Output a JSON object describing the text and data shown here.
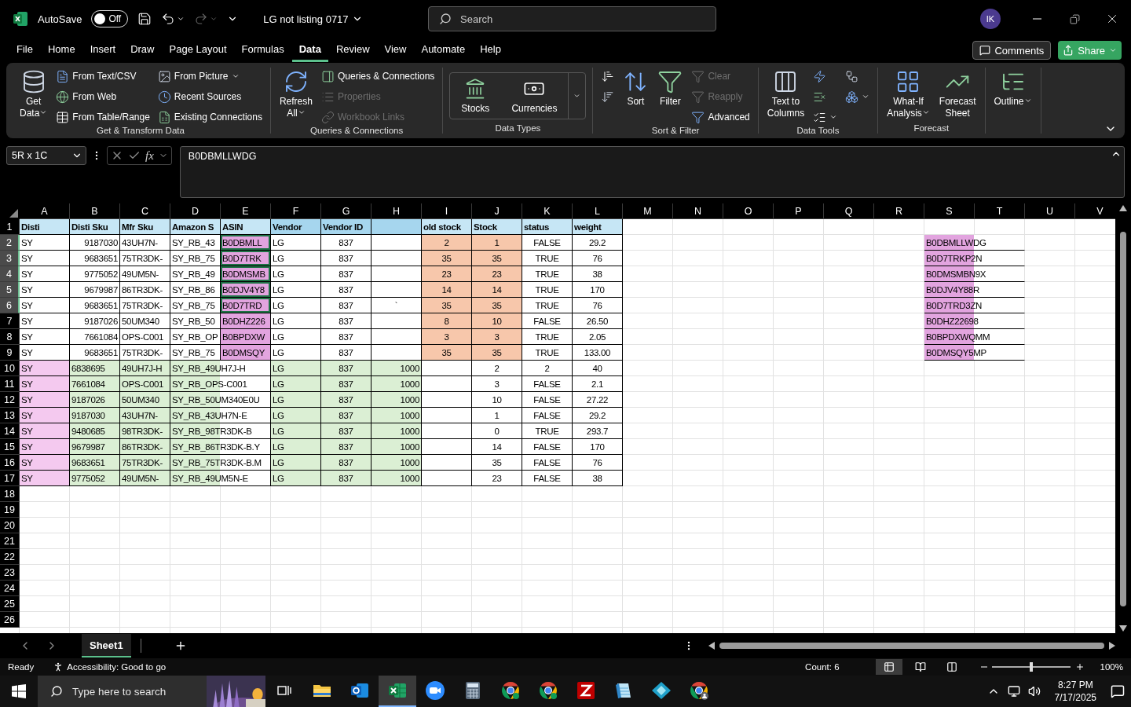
{
  "title_bar": {
    "autosave_label": "AutoSave",
    "autosave": {
      "on": false,
      "label": "Off"
    },
    "document_title": "LG not listing 0717",
    "search": {
      "placeholder": "Search"
    },
    "avatar": "IK"
  },
  "menu_tabs": [
    {
      "label": "File",
      "selected": false
    },
    {
      "label": "Home",
      "selected": false
    },
    {
      "label": "Insert",
      "selected": false
    },
    {
      "label": "Draw",
      "selected": false
    },
    {
      "label": "Page Layout",
      "selected": false
    },
    {
      "label": "Formulas",
      "selected": false
    },
    {
      "label": "Data",
      "selected": true
    },
    {
      "label": "Review",
      "selected": false
    },
    {
      "label": "View",
      "selected": false
    },
    {
      "label": "Automate",
      "selected": false
    },
    {
      "label": "Help",
      "selected": false
    }
  ],
  "menu_buttons": {
    "comments": "Comments",
    "share": "Share"
  },
  "ribbon": {
    "groups": [
      {
        "label": "Get & Transform Data",
        "items": [
          {
            "label": "Get\nData",
            "kind": "large",
            "dropdown": true,
            "disabled": false
          },
          {
            "label": "From Text/CSV",
            "kind": "small",
            "dropdown": false,
            "disabled": false
          },
          {
            "label": "From Web",
            "kind": "small",
            "dropdown": false,
            "disabled": false
          },
          {
            "label": "From Table/Range",
            "kind": "small",
            "dropdown": false,
            "disabled": false
          },
          {
            "label": "From Picture",
            "kind": "small",
            "dropdown": true,
            "disabled": false
          },
          {
            "label": "Recent Sources",
            "kind": "small",
            "dropdown": false,
            "disabled": false
          },
          {
            "label": "Existing Connections",
            "kind": "small",
            "dropdown": false,
            "disabled": false
          }
        ]
      },
      {
        "label": "Queries & Connections",
        "items": [
          {
            "label": "Refresh\nAll",
            "kind": "large",
            "dropdown": true,
            "disabled": false
          },
          {
            "label": "Queries & Connections",
            "kind": "small",
            "dropdown": false,
            "disabled": false
          },
          {
            "label": "Properties",
            "kind": "small",
            "dropdown": false,
            "disabled": true
          },
          {
            "label": "Workbook Links",
            "kind": "small",
            "dropdown": false,
            "disabled": true
          }
        ]
      },
      {
        "label": "Data Types",
        "items": [
          {
            "label": "Stocks",
            "kind": "gallery",
            "dropdown": false,
            "disabled": false
          },
          {
            "label": "Currencies",
            "kind": "gallery",
            "dropdown": false,
            "disabled": false
          }
        ]
      },
      {
        "label": "Sort & Filter",
        "items": [
          {
            "kind": "icon",
            "dropdown": false,
            "disabled": false
          },
          {
            "kind": "icon",
            "dropdown": false,
            "disabled": false
          },
          {
            "label": "Sort",
            "kind": "large",
            "dropdown": false,
            "disabled": false
          },
          {
            "label": "Filter",
            "kind": "large",
            "dropdown": false,
            "disabled": false
          },
          {
            "label": "Clear",
            "kind": "small",
            "dropdown": false,
            "disabled": true
          },
          {
            "label": "Reapply",
            "kind": "small",
            "dropdown": false,
            "disabled": true
          },
          {
            "label": "Advanced",
            "kind": "small",
            "dropdown": false,
            "disabled": false
          }
        ]
      },
      {
        "label": "Data Tools",
        "items": [
          {
            "label": "Text to\nColumns",
            "kind": "large",
            "dropdown": false,
            "disabled": false
          },
          {
            "kind": "icon",
            "dropdown": false,
            "disabled": false
          },
          {
            "kind": "icon",
            "dropdown": false,
            "disabled": false
          },
          {
            "kind": "icon",
            "dropdown": true,
            "disabled": false
          },
          {
            "kind": "icon",
            "dropdown": false,
            "disabled": false
          },
          {
            "kind": "icon",
            "dropdown": true,
            "disabled": false
          }
        ]
      },
      {
        "label": "Forecast",
        "items": [
          {
            "label": "What-If\nAnalysis",
            "kind": "large",
            "dropdown": true,
            "disabled": false
          },
          {
            "label": "Forecast\nSheet",
            "kind": "large",
            "dropdown": false,
            "disabled": false
          }
        ]
      },
      {
        "items": [
          {
            "label": "Outline",
            "kind": "large",
            "dropdown": true,
            "disabled": false
          }
        ]
      }
    ]
  },
  "formula_bar": {
    "name_box": "5R x 1C",
    "function_label": "fx",
    "formula": "B0DBMLLWDG"
  },
  "sheet": {
    "columns": [
      "A",
      "B",
      "C",
      "D",
      "E",
      "F",
      "G",
      "H",
      "I",
      "J",
      "K",
      "L",
      "M",
      "N",
      "O",
      "P",
      "Q",
      "R",
      "S",
      "T",
      "U",
      "V"
    ],
    "rows": [
      {
        "number": "1",
        "cells": [
          {
            "text": "Disti",
            "kind": "heading",
            "color": "#c6e6f5",
            "selected": false
          },
          {
            "text": "Disti Sku",
            "kind": "heading",
            "color": "#c6e6f5",
            "selected": false
          },
          {
            "text": "Mfr Sku",
            "kind": "heading",
            "color": "#c6e6f5",
            "selected": false
          },
          {
            "text": "Amazon S",
            "kind": "heading",
            "color": "#c6e6f5",
            "selected": false
          },
          {
            "text": "ASIN",
            "kind": "heading",
            "color": "#c6e6f5",
            "selected": false
          },
          {
            "text": "Vendor",
            "kind": "heading",
            "color": "#a6d6ee",
            "selected": false
          },
          {
            "text": "Vendor ID",
            "kind": "heading",
            "color": "#a6d6ee",
            "selected": false
          },
          {
            "kind": "blank",
            "color": "#a6d6ee",
            "selected": false
          },
          {
            "text": "old stock",
            "kind": "heading",
            "color": "#c6e6f5",
            "selected": false
          },
          {
            "text": "Stock",
            "kind": "heading",
            "color": "#c6e6f5",
            "selected": false
          },
          {
            "text": "status",
            "kind": "heading",
            "color": "#c6e6f5",
            "selected": false
          },
          {
            "text": "weight",
            "kind": "heading",
            "color": "#c6e6f5",
            "selected": false
          }
        ]
      },
      {
        "number": "2",
        "cells": [
          {
            "text": "SY",
            "kind": "text",
            "selected": false
          },
          {
            "text": "9187030",
            "kind": "number",
            "selected": false
          },
          {
            "text": "43UH7N-",
            "kind": "text",
            "selected": false
          },
          {
            "text": "SY_RB_43",
            "kind": "text",
            "selected": false
          },
          {
            "text": "B0DBMLL",
            "kind": "text",
            "color": "#e2a4df",
            "selected": true
          },
          {
            "text": "LG",
            "kind": "text",
            "selected": false
          },
          {
            "text": "837",
            "kind": "center",
            "selected": false
          },
          {
            "kind": "blank",
            "selected": false
          },
          {
            "text": "2",
            "kind": "center",
            "color": "#f7c7ab",
            "selected": false
          },
          {
            "text": "1",
            "kind": "center",
            "color": "#f7c7ab",
            "selected": false
          },
          {
            "text": "FALSE",
            "kind": "center",
            "selected": false
          },
          {
            "text": "29.2",
            "kind": "center",
            "selected": false
          },
          {
            "kind": "empty"
          },
          {
            "kind": "empty"
          },
          {
            "kind": "empty"
          },
          {
            "kind": "empty"
          },
          {
            "kind": "empty"
          },
          {
            "kind": "empty"
          },
          {
            "text": "B0DBMLLWDG",
            "kind": "text",
            "color": "#e2a4df",
            "overflow": true,
            "selected": false
          }
        ]
      },
      {
        "number": "3",
        "cells": [
          {
            "text": "SY",
            "kind": "text",
            "selected": false
          },
          {
            "text": "9683651",
            "kind": "number",
            "selected": false
          },
          {
            "text": "75TR3DK-",
            "kind": "text",
            "selected": false
          },
          {
            "text": "SY_RB_75",
            "kind": "text",
            "selected": false
          },
          {
            "text": "B0D7TRK",
            "kind": "text",
            "color": "#e2a4df",
            "selected": true
          },
          {
            "text": "LG",
            "kind": "text",
            "selected": false
          },
          {
            "text": "837",
            "kind": "center",
            "selected": false
          },
          {
            "kind": "blank",
            "selected": false
          },
          {
            "text": "35",
            "kind": "center",
            "color": "#f7c7ab",
            "selected": false
          },
          {
            "text": "35",
            "kind": "center",
            "color": "#f7c7ab",
            "selected": false
          },
          {
            "text": "TRUE",
            "kind": "center",
            "selected": false
          },
          {
            "text": "76",
            "kind": "center",
            "selected": false
          },
          {
            "kind": "empty"
          },
          {
            "kind": "empty"
          },
          {
            "kind": "empty"
          },
          {
            "kind": "empty"
          },
          {
            "kind": "empty"
          },
          {
            "kind": "empty"
          },
          {
            "text": "B0D7TRKP2N",
            "kind": "text",
            "color": "#e2a4df",
            "overflow": true,
            "selected": false
          }
        ]
      },
      {
        "number": "4",
        "cells": [
          {
            "text": "SY",
            "kind": "text",
            "selected": false
          },
          {
            "text": "9775052",
            "kind": "number",
            "selected": false
          },
          {
            "text": "49UM5N-",
            "kind": "text",
            "selected": false
          },
          {
            "text": "SY_RB_49",
            "kind": "text",
            "selected": false
          },
          {
            "text": "B0DMSMB",
            "kind": "text",
            "color": "#e2a4df",
            "selected": true
          },
          {
            "text": "LG",
            "kind": "text",
            "selected": false
          },
          {
            "text": "837",
            "kind": "center",
            "selected": false
          },
          {
            "kind": "blank",
            "selected": false
          },
          {
            "text": "23",
            "kind": "center",
            "color": "#f7c7ab",
            "selected": false
          },
          {
            "text": "23",
            "kind": "center",
            "color": "#f7c7ab",
            "selected": false
          },
          {
            "text": "TRUE",
            "kind": "center",
            "selected": false
          },
          {
            "text": "38",
            "kind": "center",
            "selected": false
          },
          {
            "kind": "empty"
          },
          {
            "kind": "empty"
          },
          {
            "kind": "empty"
          },
          {
            "kind": "empty"
          },
          {
            "kind": "empty"
          },
          {
            "kind": "empty"
          },
          {
            "text": "B0DMSMBN9X",
            "kind": "text",
            "color": "#e2a4df",
            "overflow": true,
            "selected": false
          }
        ]
      },
      {
        "number": "5",
        "cells": [
          {
            "text": "SY",
            "kind": "text",
            "selected": false
          },
          {
            "text": "9679987",
            "kind": "number",
            "selected": false
          },
          {
            "text": "86TR3DK-",
            "kind": "text",
            "selected": false
          },
          {
            "text": "SY_RB_86",
            "kind": "text",
            "selected": false
          },
          {
            "text": "B0DJV4Y8",
            "kind": "text",
            "color": "#e2a4df",
            "selected": true
          },
          {
            "text": "LG",
            "kind": "text",
            "selected": false
          },
          {
            "text": "837",
            "kind": "center",
            "selected": false
          },
          {
            "kind": "blank",
            "selected": false
          },
          {
            "text": "14",
            "kind": "center",
            "color": "#f7c7ab",
            "selected": false
          },
          {
            "text": "14",
            "kind": "center",
            "color": "#f7c7ab",
            "selected": false
          },
          {
            "text": "TRUE",
            "kind": "center",
            "selected": false
          },
          {
            "text": "170",
            "kind": "center",
            "selected": false
          },
          {
            "kind": "empty"
          },
          {
            "kind": "empty"
          },
          {
            "kind": "empty"
          },
          {
            "kind": "empty"
          },
          {
            "kind": "empty"
          },
          {
            "kind": "empty"
          },
          {
            "text": "B0DJV4Y88R",
            "kind": "text",
            "color": "#e2a4df",
            "overflow": true,
            "selected": false
          }
        ]
      },
      {
        "number": "6",
        "cells": [
          {
            "text": "SY",
            "kind": "text",
            "selected": false
          },
          {
            "text": "9683651",
            "kind": "number",
            "selected": false
          },
          {
            "text": "75TR3DK-",
            "kind": "text",
            "selected": false
          },
          {
            "text": "SY_RB_75",
            "kind": "text",
            "selected": false
          },
          {
            "text": "B0D7TRD",
            "kind": "text",
            "color": "#e2a4df",
            "selected": true
          },
          {
            "text": "LG",
            "kind": "text",
            "selected": false
          },
          {
            "text": "837",
            "kind": "center",
            "selected": false
          },
          {
            "text": "`",
            "kind": "center",
            "selected": false
          },
          {
            "text": "35",
            "kind": "center",
            "color": "#f7c7ab",
            "selected": false
          },
          {
            "text": "35",
            "kind": "center",
            "color": "#f7c7ab",
            "selected": false
          },
          {
            "text": "TRUE",
            "kind": "center",
            "selected": false
          },
          {
            "text": "76",
            "kind": "center",
            "selected": false
          },
          {
            "kind": "empty"
          },
          {
            "kind": "empty"
          },
          {
            "kind": "empty"
          },
          {
            "kind": "empty"
          },
          {
            "kind": "empty"
          },
          {
            "kind": "empty"
          },
          {
            "text": "B0D7TRD3ZN",
            "kind": "text",
            "color": "#e2a4df",
            "overflow": true,
            "selected": false
          }
        ]
      },
      {
        "number": "7",
        "cells": [
          {
            "text": "SY",
            "kind": "text",
            "selected": false
          },
          {
            "text": "9187026",
            "kind": "number",
            "selected": false
          },
          {
            "text": "50UM340",
            "kind": "text",
            "selected": false
          },
          {
            "text": "SY_RB_50",
            "kind": "text",
            "selected": false
          },
          {
            "text": "B0DHZ226",
            "kind": "text",
            "color": "#e2a4df",
            "selected": false
          },
          {
            "text": "LG",
            "kind": "text",
            "selected": false
          },
          {
            "text": "837",
            "kind": "center",
            "selected": false
          },
          {
            "kind": "blank",
            "selected": false
          },
          {
            "text": "8",
            "kind": "center",
            "color": "#f7c7ab",
            "selected": false
          },
          {
            "text": "10",
            "kind": "center",
            "color": "#f7c7ab",
            "selected": false
          },
          {
            "text": "FALSE",
            "kind": "center",
            "selected": false
          },
          {
            "text": "26.50",
            "kind": "center",
            "selected": false
          },
          {
            "kind": "empty"
          },
          {
            "kind": "empty"
          },
          {
            "kind": "empty"
          },
          {
            "kind": "empty"
          },
          {
            "kind": "empty"
          },
          {
            "kind": "empty"
          },
          {
            "text": "B0DHZ22698",
            "kind": "text",
            "color": "#e2a4df",
            "overflow": true,
            "selected": false
          }
        ]
      },
      {
        "number": "8",
        "cells": [
          {
            "text": "SY",
            "kind": "text",
            "selected": false
          },
          {
            "text": "7661084",
            "kind": "number",
            "selected": false
          },
          {
            "text": "OPS-C001",
            "kind": "text",
            "selected": false
          },
          {
            "text": "SY_RB_OP",
            "kind": "text",
            "selected": false
          },
          {
            "text": "B0BPDXW",
            "kind": "text",
            "color": "#e2a4df",
            "selected": false
          },
          {
            "text": "LG",
            "kind": "text",
            "selected": false
          },
          {
            "text": "837",
            "kind": "center",
            "selected": false
          },
          {
            "kind": "blank",
            "selected": false
          },
          {
            "text": "3",
            "kind": "center",
            "color": "#f7c7ab",
            "selected": false
          },
          {
            "text": "3",
            "kind": "center",
            "color": "#f7c7ab",
            "selected": false
          },
          {
            "text": "TRUE",
            "kind": "center",
            "selected": false
          },
          {
            "text": "2.05",
            "kind": "center",
            "selected": false
          },
          {
            "kind": "empty"
          },
          {
            "kind": "empty"
          },
          {
            "kind": "empty"
          },
          {
            "kind": "empty"
          },
          {
            "kind": "empty"
          },
          {
            "kind": "empty"
          },
          {
            "text": "B0BPDXWQMM",
            "kind": "text",
            "color": "#e2a4df",
            "overflow": true,
            "selected": false
          }
        ]
      },
      {
        "number": "9",
        "cells": [
          {
            "text": "SY",
            "kind": "text",
            "selected": false
          },
          {
            "text": "9683651",
            "kind": "number",
            "selected": false
          },
          {
            "text": "75TR3DK-",
            "kind": "text",
            "selected": false
          },
          {
            "text": "SY_RB_75",
            "kind": "text",
            "selected": false
          },
          {
            "text": "B0DMSQY",
            "kind": "text",
            "color": "#e2a4df",
            "selected": false
          },
          {
            "text": "LG",
            "kind": "text",
            "selected": false
          },
          {
            "text": "837",
            "kind": "center",
            "selected": false
          },
          {
            "kind": "blank",
            "selected": false
          },
          {
            "text": "35",
            "kind": "center",
            "color": "#f7c7ab",
            "selected": false
          },
          {
            "text": "35",
            "kind": "center",
            "color": "#f7c7ab",
            "selected": false
          },
          {
            "text": "TRUE",
            "kind": "center",
            "selected": false
          },
          {
            "text": "133.00",
            "kind": "center",
            "selected": false
          },
          {
            "kind": "empty"
          },
          {
            "kind": "empty"
          },
          {
            "kind": "empty"
          },
          {
            "kind": "empty"
          },
          {
            "kind": "empty"
          },
          {
            "kind": "empty"
          },
          {
            "text": "B0DMSQY5MP",
            "kind": "text",
            "color": "#e2a4df",
            "overflow": true,
            "selected": false
          }
        ]
      },
      {
        "number": "10",
        "cells": [
          {
            "text": "SY",
            "kind": "text",
            "color": "#f4c9ef",
            "selected": false
          },
          {
            "text": "6838695",
            "kind": "text",
            "color": "#dbefd4",
            "selected": false
          },
          {
            "text": "49UH7J-H",
            "kind": "text",
            "color": "#dbefd4",
            "selected": false
          },
          {
            "text": "SY_RB_49UH7J-H",
            "kind": "text",
            "color": "#dbefd4",
            "overflow": true,
            "selected": false
          },
          {
            "text": "LG",
            "kind": "text",
            "color": "#dbefd4",
            "selected": false
          },
          {
            "text": "837",
            "kind": "center",
            "color": "#dbefd4",
            "selected": false
          },
          {
            "text": "1000",
            "kind": "number",
            "color": "#dbefd4",
            "selected": false
          },
          {
            "kind": "blank",
            "selected": false
          },
          {
            "text": "2",
            "kind": "center",
            "selected": false
          },
          {
            "text": "2",
            "kind": "center",
            "selected": false
          },
          {
            "text": "40",
            "kind": "center",
            "selected": false
          }
        ]
      },
      {
        "number": "11",
        "cells": [
          {
            "text": "SY",
            "kind": "text",
            "color": "#f4c9ef",
            "selected": false
          },
          {
            "text": "7661084",
            "kind": "text",
            "color": "#dbefd4",
            "selected": false
          },
          {
            "text": "OPS-C001",
            "kind": "text",
            "color": "#dbefd4",
            "selected": false
          },
          {
            "text": "SY_RB_OPS-C001",
            "kind": "text",
            "color": "#dbefd4",
            "overflow": true,
            "selected": false
          },
          {
            "text": "LG",
            "kind": "text",
            "color": "#dbefd4",
            "selected": false
          },
          {
            "text": "837",
            "kind": "center",
            "color": "#dbefd4",
            "selected": false
          },
          {
            "text": "1000",
            "kind": "number",
            "color": "#dbefd4",
            "selected": false
          },
          {
            "kind": "blank",
            "selected": false
          },
          {
            "text": "3",
            "kind": "center",
            "selected": false
          },
          {
            "text": "FALSE",
            "kind": "center",
            "selected": false
          },
          {
            "text": "2.1",
            "kind": "center",
            "selected": false
          }
        ]
      },
      {
        "number": "12",
        "cells": [
          {
            "text": "SY",
            "kind": "text",
            "color": "#f4c9ef",
            "selected": false
          },
          {
            "text": "9187026",
            "kind": "text",
            "color": "#dbefd4",
            "selected": false
          },
          {
            "text": "50UM340",
            "kind": "text",
            "color": "#dbefd4",
            "selected": false
          },
          {
            "text": "SY_RB_50UM340E0U",
            "kind": "text",
            "color": "#dbefd4",
            "overflow": true,
            "selected": false
          },
          {
            "text": "LG",
            "kind": "text",
            "color": "#dbefd4",
            "selected": false
          },
          {
            "text": "837",
            "kind": "center",
            "color": "#dbefd4",
            "selected": false
          },
          {
            "text": "1000",
            "kind": "number",
            "color": "#dbefd4",
            "selected": false
          },
          {
            "kind": "blank",
            "selected": false
          },
          {
            "text": "10",
            "kind": "center",
            "selected": false
          },
          {
            "text": "FALSE",
            "kind": "center",
            "selected": false
          },
          {
            "text": "27.22",
            "kind": "center",
            "selected": false
          }
        ]
      },
      {
        "number": "13",
        "cells": [
          {
            "text": "SY",
            "kind": "text",
            "color": "#f4c9ef",
            "selected": false
          },
          {
            "text": "9187030",
            "kind": "text",
            "color": "#dbefd4",
            "selected": false
          },
          {
            "text": "43UH7N-",
            "kind": "text",
            "color": "#dbefd4",
            "selected": false
          },
          {
            "text": "SY_RB_43UH7N-E",
            "kind": "text",
            "color": "#dbefd4",
            "overflow": true,
            "selected": false
          },
          {
            "text": "LG",
            "kind": "text",
            "color": "#dbefd4",
            "selected": false
          },
          {
            "text": "837",
            "kind": "center",
            "color": "#dbefd4",
            "selected": false
          },
          {
            "text": "1000",
            "kind": "number",
            "color": "#dbefd4",
            "selected": false
          },
          {
            "kind": "blank",
            "selected": false
          },
          {
            "text": "1",
            "kind": "center",
            "selected": false
          },
          {
            "text": "FALSE",
            "kind": "center",
            "selected": false
          },
          {
            "text": "29.2",
            "kind": "center",
            "selected": false
          }
        ]
      },
      {
        "number": "14",
        "cells": [
          {
            "text": "SY",
            "kind": "text",
            "color": "#f4c9ef",
            "selected": false
          },
          {
            "text": "9480685",
            "kind": "text",
            "color": "#dbefd4",
            "selected": false
          },
          {
            "text": "98TR3DK-",
            "kind": "text",
            "color": "#dbefd4",
            "selected": false
          },
          {
            "text": "SY_RB_98TR3DK-B",
            "kind": "text",
            "color": "#dbefd4",
            "overflow": true,
            "selected": false
          },
          {
            "text": "LG",
            "kind": "text",
            "color": "#dbefd4",
            "selected": false
          },
          {
            "text": "837",
            "kind": "center",
            "color": "#dbefd4",
            "selected": false
          },
          {
            "text": "1000",
            "kind": "number",
            "color": "#dbefd4",
            "selected": false
          },
          {
            "kind": "blank",
            "selected": false
          },
          {
            "text": "0",
            "kind": "center",
            "selected": false
          },
          {
            "text": "TRUE",
            "kind": "center",
            "selected": false
          },
          {
            "text": "293.7",
            "kind": "center",
            "selected": false
          }
        ]
      },
      {
        "number": "15",
        "cells": [
          {
            "text": "SY",
            "kind": "text",
            "color": "#f4c9ef",
            "selected": false
          },
          {
            "text": "9679987",
            "kind": "text",
            "color": "#dbefd4",
            "selected": false
          },
          {
            "text": "86TR3DK-",
            "kind": "text",
            "color": "#dbefd4",
            "selected": false
          },
          {
            "text": "SY_RB_86TR3DK-B.Y",
            "kind": "text",
            "color": "#dbefd4",
            "overflow": true,
            "selected": false
          },
          {
            "text": "LG",
            "kind": "text",
            "color": "#dbefd4",
            "selected": false
          },
          {
            "text": "837",
            "kind": "center",
            "color": "#dbefd4",
            "selected": false
          },
          {
            "text": "1000",
            "kind": "number",
            "color": "#dbefd4",
            "selected": false
          },
          {
            "kind": "blank",
            "selected": false
          },
          {
            "text": "14",
            "kind": "center",
            "selected": false
          },
          {
            "text": "FALSE",
            "kind": "center",
            "selected": false
          },
          {
            "text": "170",
            "kind": "center",
            "selected": false
          }
        ]
      },
      {
        "number": "16",
        "cells": [
          {
            "text": "SY",
            "kind": "text",
            "color": "#f4c9ef",
            "selected": false
          },
          {
            "text": "9683651",
            "kind": "text",
            "color": "#dbefd4",
            "selected": false
          },
          {
            "text": "75TR3DK-",
            "kind": "text",
            "color": "#dbefd4",
            "selected": false
          },
          {
            "text": "SY_RB_75TR3DK-B.M",
            "kind": "text",
            "color": "#dbefd4",
            "overflow": true,
            "selected": false
          },
          {
            "text": "LG",
            "kind": "text",
            "color": "#dbefd4",
            "selected": false
          },
          {
            "text": "837",
            "kind": "center",
            "color": "#dbefd4",
            "selected": false
          },
          {
            "text": "1000",
            "kind": "number",
            "color": "#dbefd4",
            "selected": false
          },
          {
            "kind": "blank",
            "selected": false
          },
          {
            "text": "35",
            "kind": "center",
            "selected": false
          },
          {
            "text": "FALSE",
            "kind": "center",
            "selected": false
          },
          {
            "text": "76",
            "kind": "center",
            "selected": false
          }
        ]
      },
      {
        "number": "17",
        "cells": [
          {
            "text": "SY",
            "kind": "text",
            "color": "#f4c9ef",
            "selected": false
          },
          {
            "text": "9775052",
            "kind": "text",
            "color": "#dbefd4",
            "selected": false
          },
          {
            "text": "49UM5N-",
            "kind": "text",
            "color": "#dbefd4",
            "selected": false
          },
          {
            "text": "SY_RB_49UM5N-E",
            "kind": "text",
            "color": "#dbefd4",
            "overflow": true,
            "selected": false
          },
          {
            "text": "LG",
            "kind": "text",
            "color": "#dbefd4",
            "selected": false
          },
          {
            "text": "837",
            "kind": "center",
            "color": "#dbefd4",
            "selected": false
          },
          {
            "text": "1000",
            "kind": "number",
            "color": "#dbefd4",
            "selected": false
          },
          {
            "kind": "blank",
            "selected": false
          },
          {
            "text": "23",
            "kind": "center",
            "selected": false
          },
          {
            "text": "FALSE",
            "kind": "center",
            "selected": false
          },
          {
            "text": "38",
            "kind": "center",
            "selected": false
          }
        ]
      },
      {
        "number": "18"
      },
      {
        "number": "19"
      },
      {
        "number": "20"
      },
      {
        "number": "21"
      },
      {
        "number": "22"
      },
      {
        "number": "23"
      },
      {
        "number": "24"
      },
      {
        "number": "25"
      },
      {
        "number": "26"
      }
    ]
  },
  "sheet_tabs": [
    {
      "label": "Sheet1",
      "selected": true
    }
  ],
  "status_bar": {
    "mode": "Ready",
    "accessibility": "Accessibility: Good to go",
    "count": "Count: 6",
    "views": [
      {
        "kind": "normal",
        "selected": true
      },
      {
        "kind": "layout",
        "selected": false
      },
      {
        "kind": "breaks",
        "selected": false
      }
    ],
    "zoom": {
      "level": 0.5,
      "label": "100%"
    }
  },
  "taskbar": {
    "search": {
      "placeholder": "Type here to search"
    },
    "apps": [
      {
        "kind": "taskview",
        "selected": false
      },
      {
        "kind": "folder",
        "selected": false
      },
      {
        "kind": "mail",
        "selected": false
      },
      {
        "kind": "sheet",
        "selected": true
      },
      {
        "kind": "camera",
        "selected": false
      },
      {
        "kind": "calculator",
        "selected": false
      },
      {
        "kind": "wheel",
        "selected": false
      },
      {
        "kind": "wheel",
        "selected": false
      },
      {
        "kind": "stripe",
        "selected": false
      },
      {
        "kind": "pad",
        "selected": false
      },
      {
        "kind": "diamond",
        "selected": false
      },
      {
        "kind": "wheeluser",
        "selected": false
      }
    ],
    "time": "8:27 PM",
    "date": "7/17/2025"
  }
}
